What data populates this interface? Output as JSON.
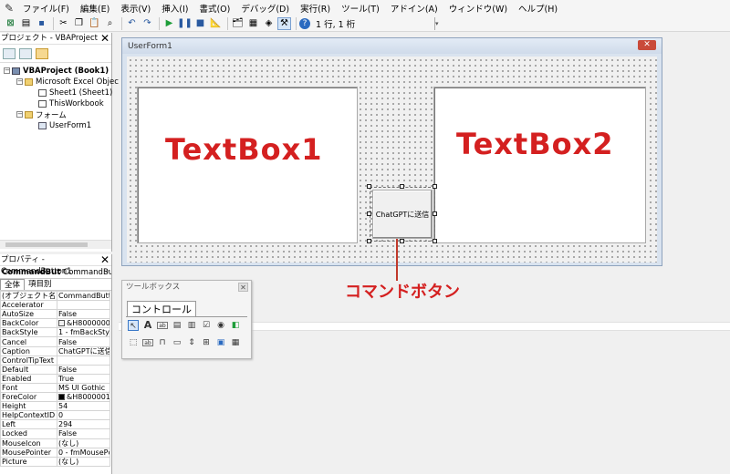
{
  "menu": [
    "ファイル(F)",
    "編集(E)",
    "表示(V)",
    "挿入(I)",
    "書式(O)",
    "デバッグ(D)",
    "実行(R)",
    "ツール(T)",
    "アドイン(A)",
    "ウィンドウ(W)",
    "ヘルプ(H)"
  ],
  "toolbar": {
    "cursor_position": "1 行, 1 桁"
  },
  "project_pane": {
    "title": "プロジェクト - VBAProject",
    "tree": {
      "project": "VBAProject (Book1)",
      "excel_objects": "Microsoft Excel Objects",
      "sheet1": "Sheet1 (Sheet1)",
      "this_workbook": "ThisWorkbook",
      "forms": "フォーム",
      "userform1": "UserForm1"
    }
  },
  "properties_pane": {
    "title": "プロパティ - CommandButton1",
    "object_name": "CommandBut",
    "object_type": "CommandButt",
    "tabs": [
      "全体",
      "項目別"
    ],
    "rows": [
      {
        "name": "(オブジェクト名)",
        "value": "CommandButto"
      },
      {
        "name": "Accelerator",
        "value": ""
      },
      {
        "name": "AutoSize",
        "value": "False"
      },
      {
        "name": "BackColor",
        "value": "&H8000000F",
        "swatch": "#f0f0f0"
      },
      {
        "name": "BackStyle",
        "value": "1 - fmBackSty"
      },
      {
        "name": "Cancel",
        "value": "False"
      },
      {
        "name": "Caption",
        "value": "ChatGPTに送信"
      },
      {
        "name": "ControlTipText",
        "value": ""
      },
      {
        "name": "Default",
        "value": "False"
      },
      {
        "name": "Enabled",
        "value": "True"
      },
      {
        "name": "Font",
        "value": "MS UI Gothic"
      },
      {
        "name": "ForeColor",
        "value": "&H80000012",
        "swatch": "#000000"
      },
      {
        "name": "Height",
        "value": "54"
      },
      {
        "name": "HelpContextID",
        "value": "0"
      },
      {
        "name": "Left",
        "value": "294"
      },
      {
        "name": "Locked",
        "value": "False"
      },
      {
        "name": "MouseIcon",
        "value": "(なし)"
      },
      {
        "name": "MousePointer",
        "value": "0 - fmMousePc"
      },
      {
        "name": "Picture",
        "value": "(なし)"
      }
    ]
  },
  "userform": {
    "title": "UserForm1",
    "textbox1_label": "TextBox1",
    "textbox2_label": "TextBox2",
    "button_caption": "ChatGPTに送信"
  },
  "annotation": {
    "label": "コマンドボタン",
    "color": "#d42020"
  },
  "toolbox": {
    "title": "ツールボックス",
    "tab": "コントロール"
  }
}
